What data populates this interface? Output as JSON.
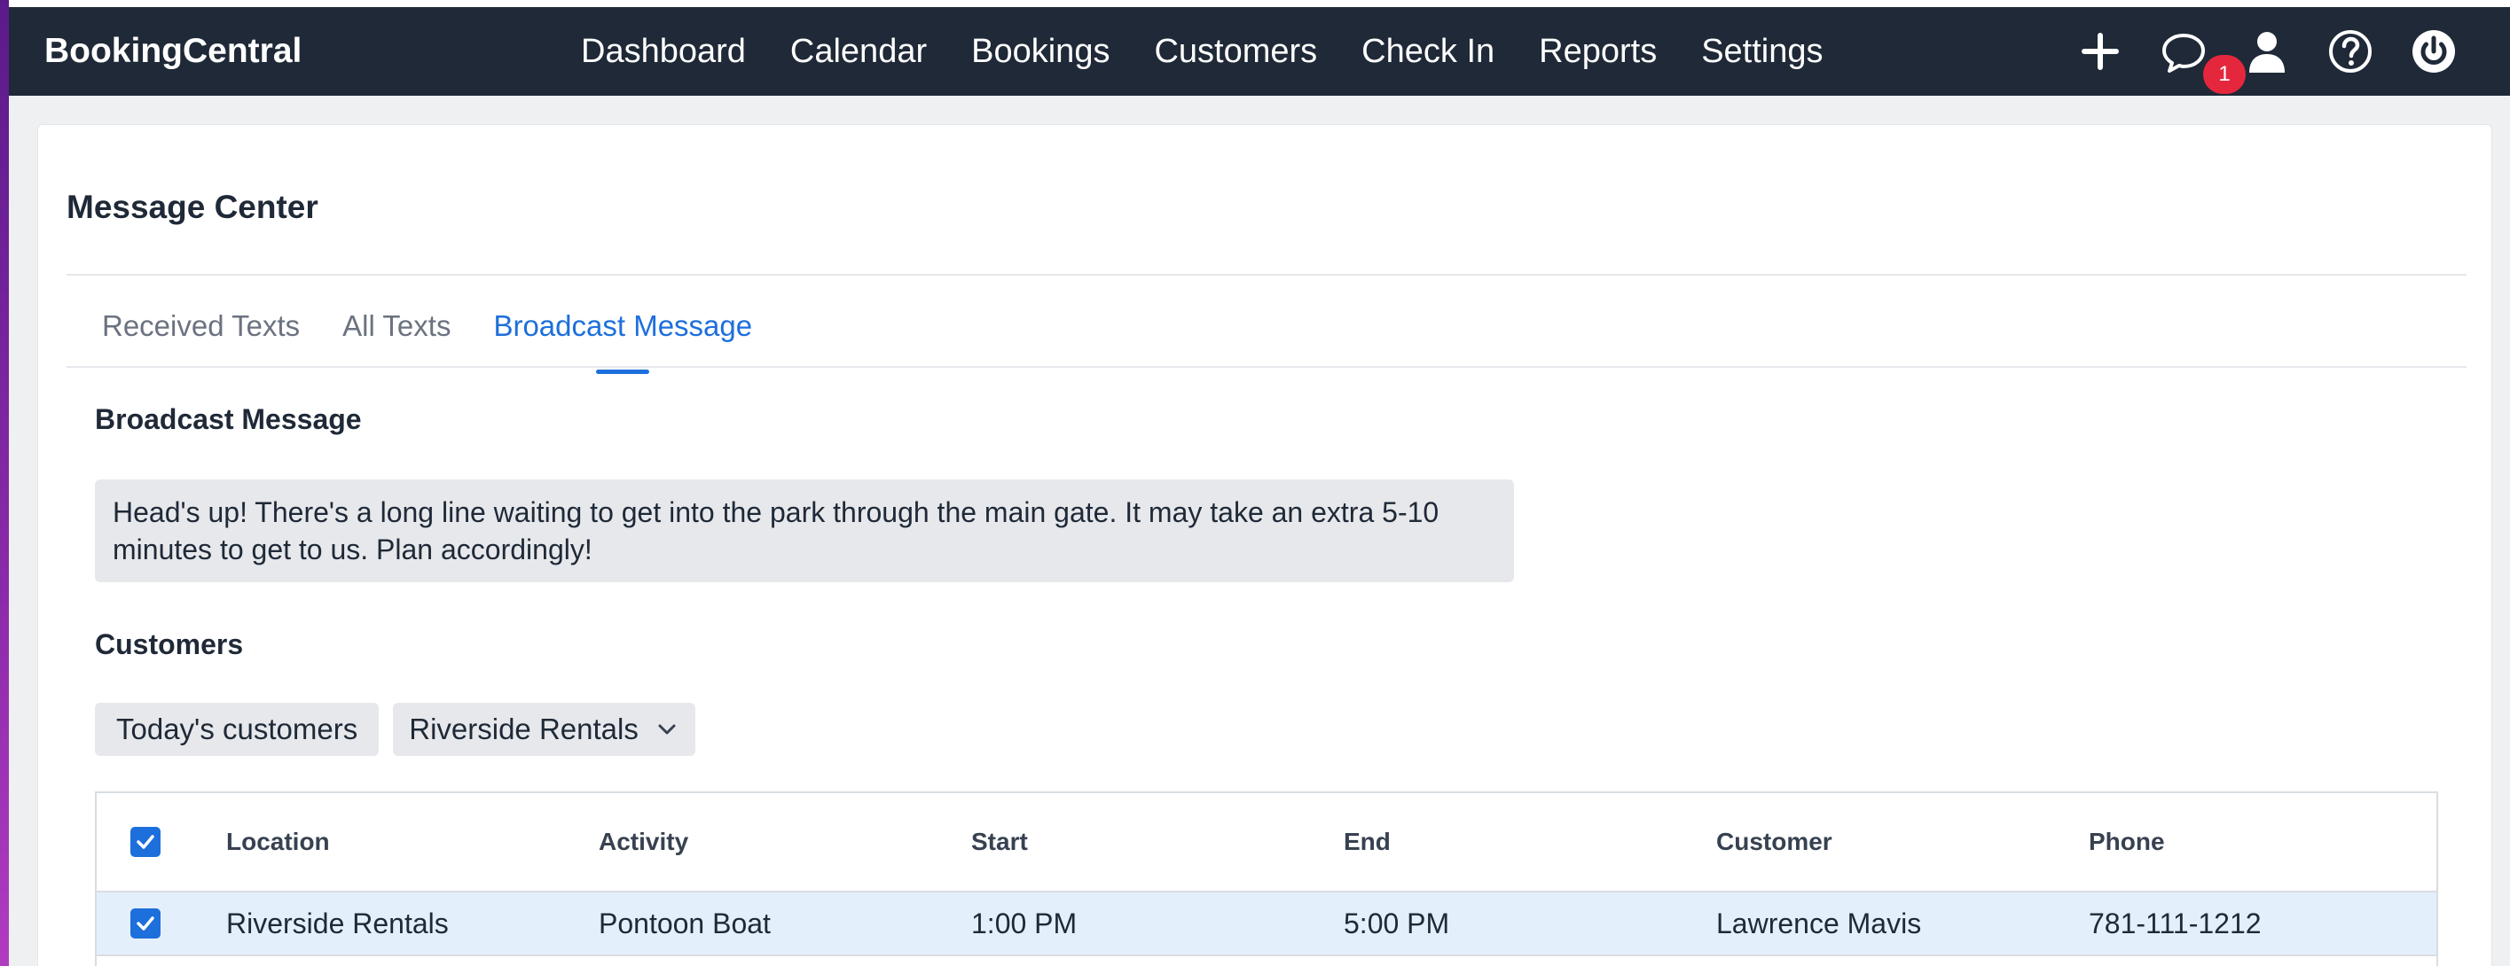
{
  "app": {
    "brand": "BookingCentral"
  },
  "nav": {
    "links": [
      "Dashboard",
      "Calendar",
      "Bookings",
      "Customers",
      "Check In",
      "Reports",
      "Settings"
    ],
    "message_badge": "1",
    "icons": [
      "plus-icon",
      "chat-icon",
      "user-icon",
      "help-icon",
      "power-icon"
    ]
  },
  "page": {
    "title": "Message Center"
  },
  "tabs": {
    "items": [
      "Received Texts",
      "All Texts",
      "Broadcast Message"
    ],
    "active": "Broadcast Message"
  },
  "broadcast": {
    "heading": "Broadcast Message",
    "message": "Head's up! There's a long line waiting to get into the park through the main gate. It may take an extra 5-10 minutes to get to us. Plan accordingly!"
  },
  "customers": {
    "heading": "Customers",
    "filter_button": "Today's customers",
    "location_select": "Riverside Rentals"
  },
  "table": {
    "columns": [
      "Location",
      "Activity",
      "Start",
      "End",
      "Customer",
      "Phone"
    ],
    "rows": [
      {
        "checked": true,
        "location": "Riverside Rentals",
        "activity": "Pontoon Boat",
        "start": "1:00 PM",
        "end": "5:00 PM",
        "customer": "Lawrence Mavis",
        "phone": "781-111-1212"
      }
    ]
  },
  "colors": {
    "navbar": "#1f2937",
    "accent": "#1d6fdc",
    "badge": "#e5273d",
    "row_highlight": "#e4effc"
  }
}
